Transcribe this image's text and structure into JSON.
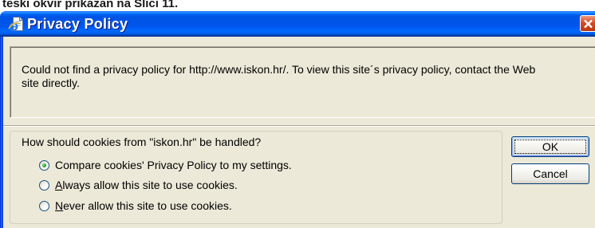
{
  "document": {
    "caption_fragment": "teski okvir prikazan na Slici 11."
  },
  "window": {
    "title": "Privacy Policy",
    "icon": "ie-document-icon",
    "close_icon": "close-icon"
  },
  "message": {
    "text": "Could not find a privacy policy for http://www.iskon.hr/. To view this site´s privacy policy, contact the Web site directly."
  },
  "cookie_handling": {
    "question": "How should cookies from \"iskon.hr\" be handled?",
    "options": [
      {
        "label": "Compare cookies' Privacy Policy to my settings.",
        "selected": true
      },
      {
        "label": "Always allow this site to use cookies.",
        "access_key": "A",
        "selected": false
      },
      {
        "label": "Never allow this site to use cookies.",
        "access_key": "N",
        "selected": false
      }
    ]
  },
  "buttons": {
    "ok": {
      "label": "OK",
      "focused": true
    },
    "cancel": {
      "label": "Cancel",
      "focused": false
    }
  },
  "colors": {
    "window_background": "#ECE9D8",
    "title_text": "#FFFFFF",
    "close_button": "#D74B27",
    "radio_selected_dot": "#21A121",
    "button_border": "#003C74"
  }
}
